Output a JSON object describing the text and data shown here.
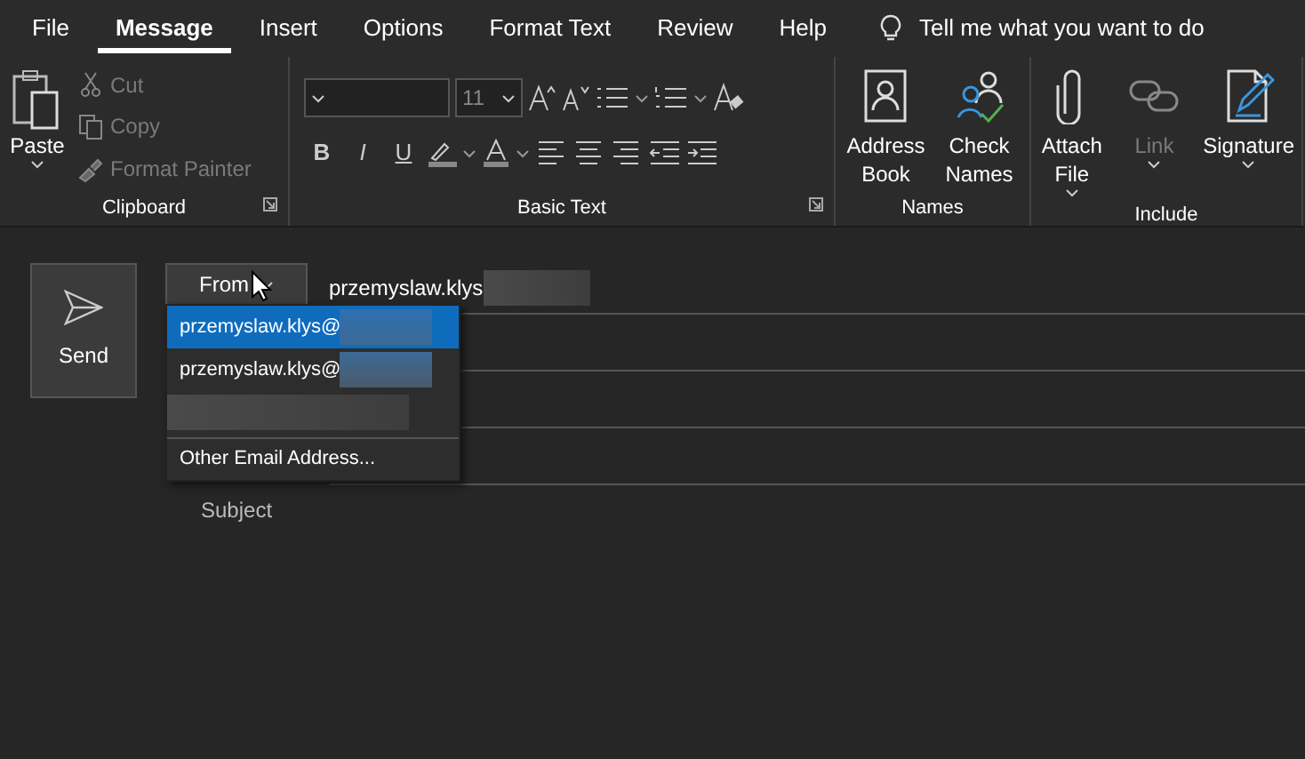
{
  "tabs": [
    {
      "label": "File",
      "selected": false
    },
    {
      "label": "Message",
      "selected": true
    },
    {
      "label": "Insert",
      "selected": false
    },
    {
      "label": "Options",
      "selected": false
    },
    {
      "label": "Format Text",
      "selected": false
    },
    {
      "label": "Review",
      "selected": false
    },
    {
      "label": "Help",
      "selected": false
    }
  ],
  "tell_me": {
    "placeholder": "Tell me what you want to do"
  },
  "clipboard": {
    "label": "Clipboard",
    "launcher": true,
    "paste": "Paste",
    "items": [
      {
        "label": "Cut",
        "disabled": true
      },
      {
        "label": "Copy",
        "disabled": true
      },
      {
        "label": "Format Painter",
        "disabled": true
      }
    ]
  },
  "basic_text": {
    "label": "Basic Text",
    "launcher": true,
    "font_size": "11",
    "format_buttons": [
      "B",
      "I",
      "U"
    ]
  },
  "names": {
    "label": "Names",
    "buttons": [
      {
        "label": "Address Book",
        "caret": false,
        "disabled": false
      },
      {
        "label": "Check Names",
        "caret": false,
        "disabled": false
      }
    ]
  },
  "include": {
    "label": "Include",
    "buttons": [
      {
        "label": "Attach File",
        "caret": true,
        "disabled": false
      },
      {
        "label": "Link",
        "caret": true,
        "disabled": true
      },
      {
        "label": "Signature",
        "caret": true,
        "disabled": false
      }
    ]
  },
  "compose": {
    "send": "Send",
    "from": "From",
    "from_value": "przemyslaw.klys",
    "from_redacted": true,
    "subject": "Subject",
    "dropdown": [
      {
        "kind": "account",
        "text": "przemyslaw.klys@",
        "redacted": true,
        "selected": true
      },
      {
        "kind": "account",
        "text": "przemyslaw.klys@",
        "redacted": true,
        "selected": false
      },
      {
        "kind": "hidden",
        "redacted": true,
        "selected": false
      },
      {
        "kind": "option",
        "text": "Other Email Address...",
        "selected": false
      }
    ]
  }
}
